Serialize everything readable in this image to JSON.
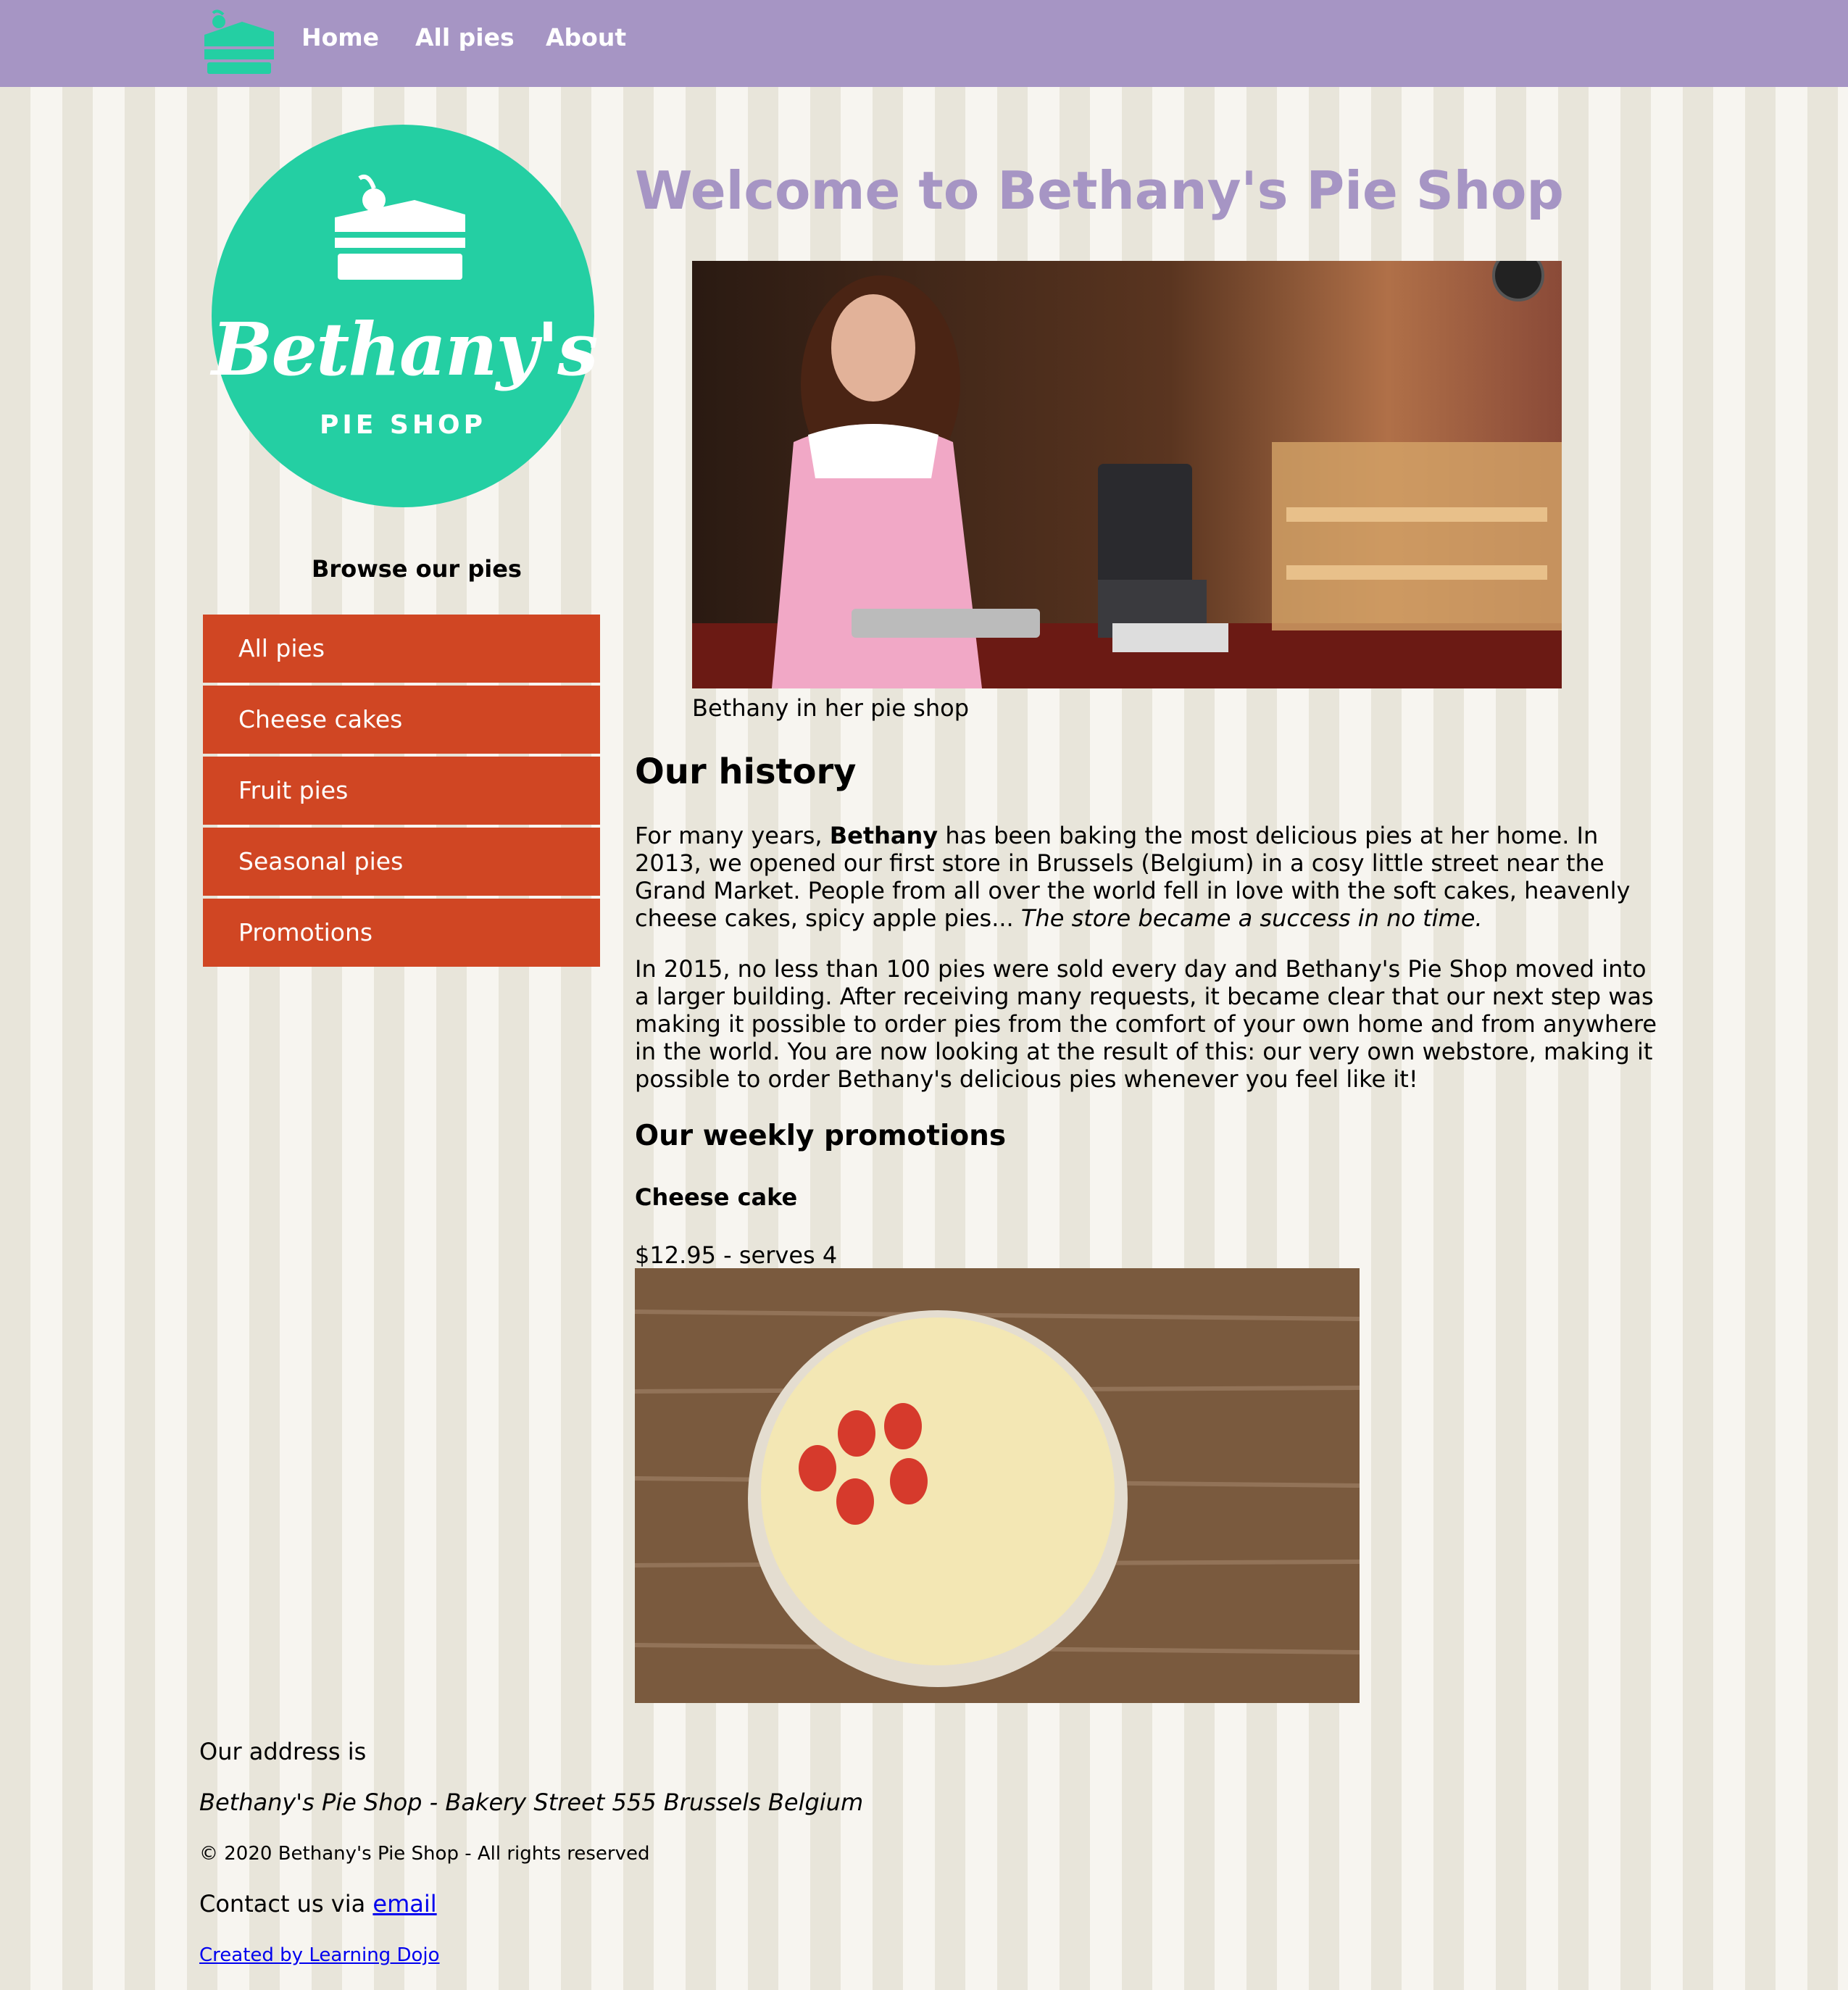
{
  "nav": {
    "home": "Home",
    "all_pies": "All pies",
    "about": "About"
  },
  "logo": {
    "name": "Bethany's",
    "sub": "PIE SHOP"
  },
  "sidebar": {
    "heading": "Browse our pies",
    "items": [
      {
        "label": "All pies"
      },
      {
        "label": "Cheese cakes"
      },
      {
        "label": "Fruit pies"
      },
      {
        "label": "Seasonal pies"
      },
      {
        "label": "Promotions"
      }
    ]
  },
  "main": {
    "title": "Welcome to Bethany's Pie Shop",
    "hero_caption": "Bethany in her pie shop",
    "history_heading": "Our history",
    "p1_a": "For many years, ",
    "p1_bold": "Bethany",
    "p1_b": " has been baking the most delicious pies at her home. In 2013, we opened our first store in Brussels (Belgium) in a cosy little street near the Grand Market. People from all over the world fell in love with the soft cakes, heavenly cheese cakes, spicy apple pies... ",
    "p1_italic": "The store became a success in no time.",
    "p2": "In 2015, no less than 100 pies were sold every day and Bethany's Pie Shop moved into a larger building. After receiving many requests, it became clear that our next step was making it possible to order pies from the comfort of your own home and from anywhere in the world. You are now looking at the result of this: our very own webstore, making it possible to order Bethany's delicious pies whenever you feel like it!",
    "promo_heading": "Our weekly promotions",
    "promo_name": "Cheese cake",
    "promo_price": "$12.95 - serves 4"
  },
  "footer": {
    "address_label": "Our address is",
    "address": "Bethany's Pie Shop - Bakery Street 555 Brussels Belgium",
    "copyright": "© 2020 Bethany's Pie Shop - All rights reserved",
    "contact_prefix": "Contact us via ",
    "contact_link": "email",
    "credit": "Created by Learning Dojo"
  },
  "colors": {
    "topbar": "#a695c4",
    "logo_green": "#24cfa3",
    "menu_red": "#d04623"
  }
}
